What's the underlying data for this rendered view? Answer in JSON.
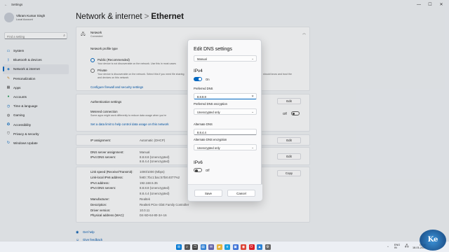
{
  "window": {
    "title": "Settings",
    "minimize": "—",
    "maximize": "☐",
    "close": "✕"
  },
  "user": {
    "name": "Vikram Kumar Singh",
    "account": "Local Account"
  },
  "search": {
    "placeholder": "Find a setting",
    "icon": "search-icon"
  },
  "sidebar": {
    "items": [
      {
        "label": "System",
        "icon": "monitor-icon",
        "color": "#0067c0"
      },
      {
        "label": "Bluetooth & devices",
        "icon": "bluetooth-icon",
        "color": "#0067c0"
      },
      {
        "label": "Network & internet",
        "icon": "wifi-icon",
        "color": "#0067c0",
        "active": true
      },
      {
        "label": "Personalization",
        "icon": "brush-icon",
        "color": "#d08a2c"
      },
      {
        "label": "Apps",
        "icon": "apps-icon",
        "color": "#555555"
      },
      {
        "label": "Accounts",
        "icon": "person-icon",
        "color": "#2a9d5b"
      },
      {
        "label": "Time & language",
        "icon": "clock-globe-icon",
        "color": "#0067c0"
      },
      {
        "label": "Gaming",
        "icon": "gamepad-icon",
        "color": "#555555"
      },
      {
        "label": "Accessibility",
        "icon": "accessibility-icon",
        "color": "#0067c0"
      },
      {
        "label": "Privacy & security",
        "icon": "shield-icon",
        "color": "#555555"
      },
      {
        "label": "Windows Update",
        "icon": "update-icon",
        "color": "#0067c0"
      }
    ]
  },
  "header": {
    "parent": "Network & internet",
    "separator": ">",
    "current": "Ethernet"
  },
  "main": {
    "network": {
      "title": "Network",
      "status": "Connected"
    },
    "profile_type": {
      "heading": "Network profile type",
      "public_label": "Public (Recommended)",
      "public_desc": "Your device is not discoverable on the network. Use this in most cases",
      "private_label": "Private",
      "private_desc": "Your device is discoverable on the network. Select this if you need file sharing",
      "private_desc2": "and devices on this network",
      "private_tail": "should know and trust the"
    },
    "firewall_link": "Configure firewall and security settings",
    "auth": {
      "label": "Authentication settings",
      "button": "Edit"
    },
    "metered": {
      "label": "Metered connection",
      "desc": "Some apps might work differently to reduce data usage when you're",
      "state": "Off"
    },
    "data_limit_link": "Set a data limit to help control data usage on this network",
    "ip": {
      "label": "IP assignment:",
      "value": "Automatic (DHCP)",
      "button": "Edit"
    },
    "dns": {
      "label": "DNS server assignment:",
      "value": "Manual",
      "button": "Edit"
    },
    "ipv4dns": {
      "label": "IPv4 DNS servers:",
      "v1": "8.8.8.8 (Unencrypted)",
      "v2": "8.8.4.4 (Unencrypted)"
    },
    "props": [
      {
        "label": "Link speed (Receive/Transmit):",
        "value": "1000/1000 (Mbps)"
      },
      {
        "label": "Link-local IPv6 address:",
        "value": "fe80::7bc1:bac:57b8:4077%2"
      },
      {
        "label": "IPv4 address:",
        "value": "192.168.5.35"
      },
      {
        "label": "IPv4 DNS servers:",
        "value": "8.8.8.8 (Unencrypted)"
      },
      {
        "label": "",
        "value": "8.8.4.4 (Unencrypted)"
      },
      {
        "label": "Manufacturer:",
        "value": "Realtek"
      },
      {
        "label": "Description:",
        "value": "Realtek PCIe GbE Family Controller"
      },
      {
        "label": "Driver version:",
        "value": "10.0.11"
      },
      {
        "label": "Physical address (MAC):",
        "value": "D4-5D-64-80-3A-16"
      }
    ],
    "copy_button": "Copy",
    "help_link": "Get help",
    "feedback_link": "Give feedback"
  },
  "dialog": {
    "title": "Edit DNS settings",
    "mode": "Manual",
    "ipv4": {
      "heading": "IPv4",
      "toggle": "On",
      "preferred_label": "Preferred DNS",
      "preferred_value": "8.8.8.8",
      "preferred_enc_label": "Preferred DNS encryption",
      "preferred_enc_value": "Unencrypted only",
      "alternate_label": "Alternate DNS",
      "alternate_value": "8.8.4.4",
      "alternate_enc_label": "Alternate DNS encryption",
      "alternate_enc_value": "Unencrypted only"
    },
    "ipv6": {
      "heading": "IPv6",
      "toggle": "Off"
    },
    "save": "Save",
    "cancel": "Cancel"
  },
  "taskbar": {
    "apps": [
      {
        "icon": "windows-start-icon",
        "color": "#0078d4"
      },
      {
        "icon": "search-icon",
        "color": "#555555"
      },
      {
        "icon": "task-view-icon",
        "color": "#444444"
      },
      {
        "icon": "widgets-icon",
        "color": "#2f7fd3"
      },
      {
        "icon": "chat-icon",
        "color": "#6264a7"
      },
      {
        "icon": "file-explorer-icon",
        "color": "#e8b33b"
      },
      {
        "icon": "edge-icon",
        "color": "#1b9ede"
      },
      {
        "icon": "store-icon",
        "color": "#3a6fd6"
      },
      {
        "icon": "chrome-icon",
        "color": "#dc4437"
      },
      {
        "icon": "opera-icon",
        "color": "#d81c25"
      },
      {
        "icon": "photos-icon",
        "color": "#2c83d6"
      },
      {
        "icon": "settings-icon",
        "color": "#666666"
      }
    ],
    "lang": "ENG",
    "region": "IN",
    "time": "15:46",
    "date": "18-01-2022"
  },
  "watermark": "Ke"
}
